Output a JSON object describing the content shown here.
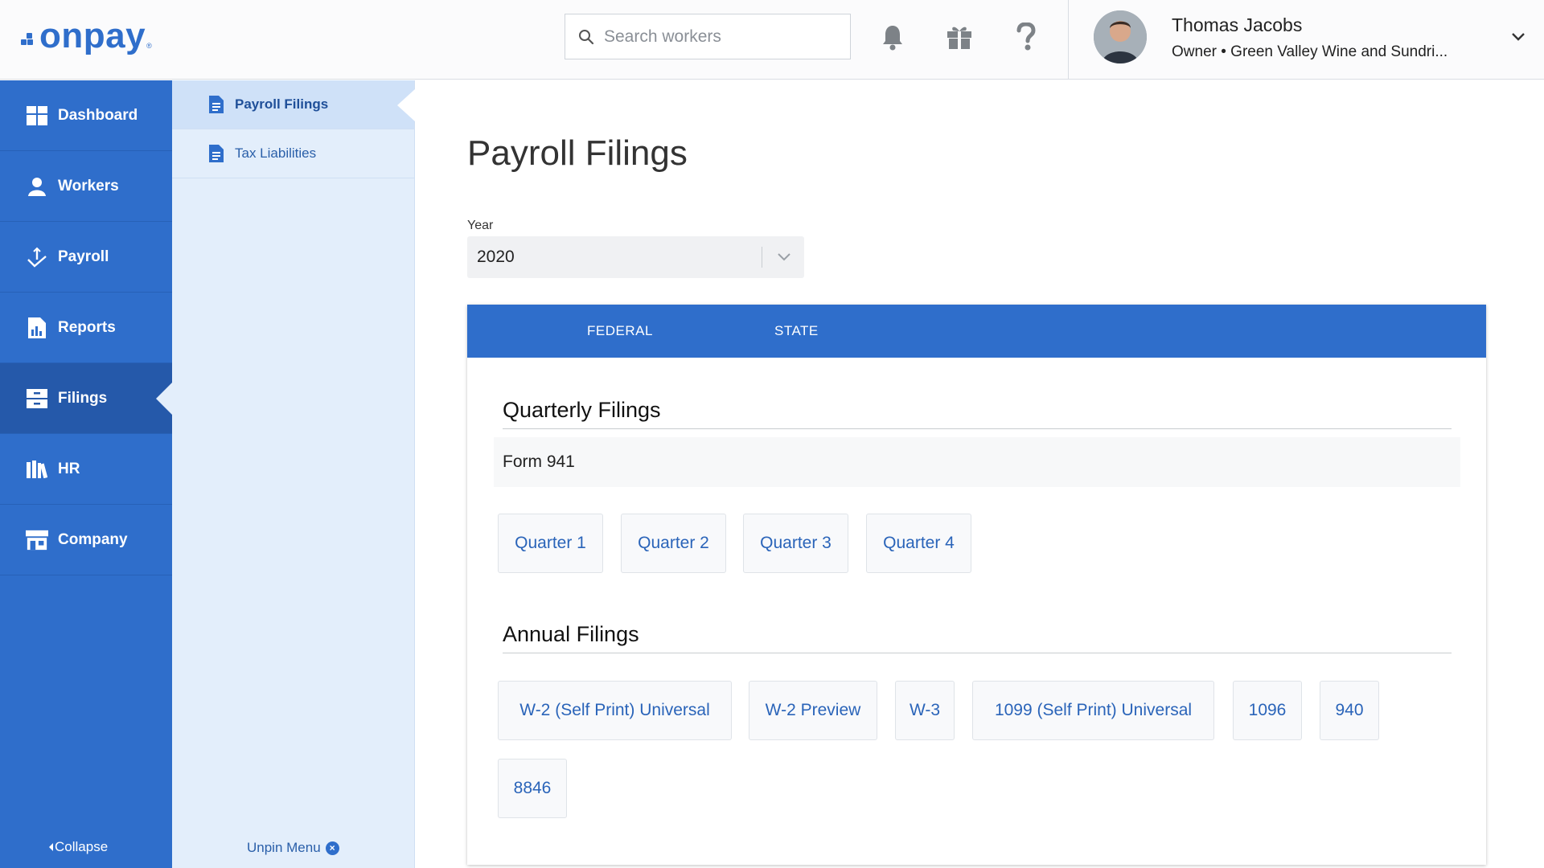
{
  "brand": {
    "name": "onpay",
    "accent": "#2f6ecb"
  },
  "header": {
    "search_placeholder": "Search workers",
    "icons": [
      "bell-icon",
      "gift-icon",
      "help-icon"
    ],
    "user": {
      "name": "Thomas Jacobs",
      "subtitle": "Owner • Green Valley Wine and Sundri..."
    }
  },
  "sidebar": {
    "items": [
      {
        "label": "Dashboard",
        "icon": "dashboard-icon"
      },
      {
        "label": "Workers",
        "icon": "workers-icon"
      },
      {
        "label": "Payroll",
        "icon": "payroll-icon"
      },
      {
        "label": "Reports",
        "icon": "reports-icon"
      },
      {
        "label": "Filings",
        "icon": "filings-icon",
        "active": true
      },
      {
        "label": "HR",
        "icon": "hr-icon"
      },
      {
        "label": "Company",
        "icon": "company-icon"
      }
    ],
    "collapse_label": "Collapse"
  },
  "subnav": {
    "items": [
      {
        "label": "Payroll Filings",
        "active": true
      },
      {
        "label": "Tax Liabilities"
      }
    ],
    "unpin_label": "Unpin Menu"
  },
  "main": {
    "title": "Payroll Filings",
    "year_label": "Year",
    "year_value": "2020",
    "tabs": [
      {
        "label": "FEDERAL",
        "active": true
      },
      {
        "label": "STATE"
      }
    ],
    "quarterly": {
      "title": "Quarterly Filings",
      "form": "Form 941",
      "buttons": [
        "Quarter 1",
        "Quarter 2",
        "Quarter 3",
        "Quarter 4"
      ]
    },
    "annual": {
      "title": "Annual Filings",
      "buttons": [
        "W-2 (Self Print) Universal",
        "W-2 Preview",
        "W-3",
        "1099 (Self Print) Universal",
        "1096",
        "940",
        "8846"
      ]
    }
  }
}
